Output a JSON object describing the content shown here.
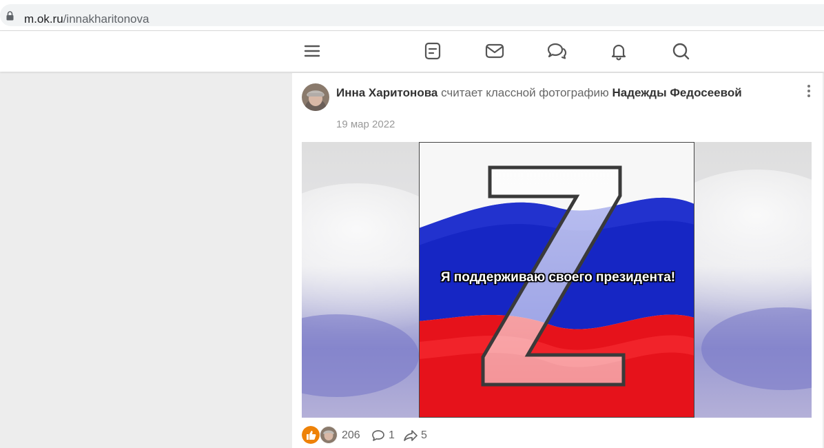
{
  "browser": {
    "url_host": "m.ok.ru",
    "url_path": "/innakharitonova"
  },
  "nav": {
    "icons": [
      "menu-icon",
      "notes-icon",
      "messages-icon",
      "discussions-icon",
      "notifications-icon",
      "search-icon"
    ]
  },
  "post": {
    "author": "Инна Харитонова",
    "action": " считает классной фотографию ",
    "target": "Надежды Федосеевой",
    "date": "19 мар 2022",
    "image_caption": "Я поддерживаю своего президента!",
    "likes": "206",
    "comments": "1",
    "shares": "5"
  },
  "colors": {
    "accent": "#ee8208",
    "flag_white": "#f2f2f2",
    "flag_blue": "#0f23c8",
    "flag_red": "#e8111a"
  }
}
